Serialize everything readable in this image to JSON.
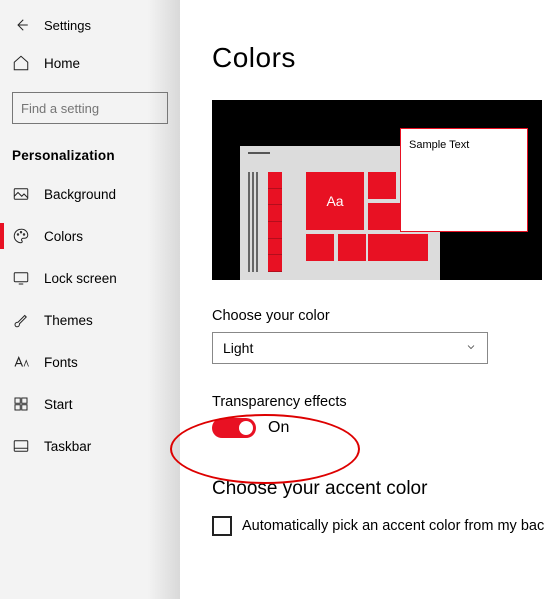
{
  "header": {
    "back_window_title": "Settings"
  },
  "sidebar": {
    "home": "Home",
    "search_placeholder": "Find a setting",
    "section": "Personalization",
    "items": [
      {
        "label": "Background"
      },
      {
        "label": "Colors"
      },
      {
        "label": "Lock screen"
      },
      {
        "label": "Themes"
      },
      {
        "label": "Fonts"
      },
      {
        "label": "Start"
      },
      {
        "label": "Taskbar"
      }
    ]
  },
  "main": {
    "title": "Colors",
    "preview": {
      "sample_text": "Sample Text",
      "tile_glyph": "Aa"
    },
    "color_mode": {
      "label": "Choose your color",
      "value": "Light"
    },
    "transparency": {
      "label": "Transparency effects",
      "value": "On",
      "enabled": true
    },
    "accent": {
      "title": "Choose your accent color",
      "auto_label": "Automatically pick an accent color from my bac",
      "auto_checked": false
    }
  }
}
